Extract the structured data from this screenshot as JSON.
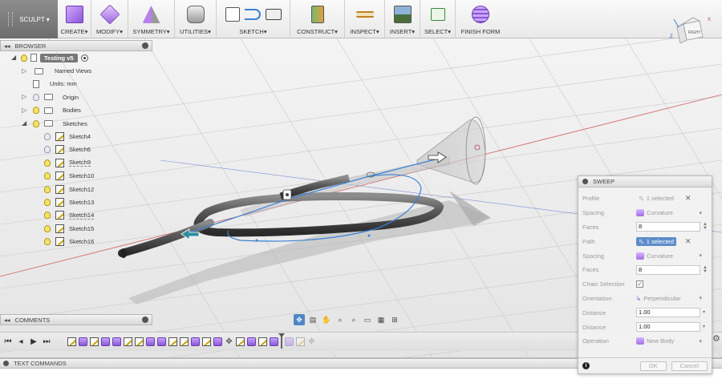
{
  "workspace": {
    "label": "SCULPT"
  },
  "toolbar": {
    "groups": [
      {
        "label": "CREATE"
      },
      {
        "label": "MODIFY"
      },
      {
        "label": "SYMMETRY"
      },
      {
        "label": "UTILITIES"
      },
      {
        "label": "SKETCH"
      },
      {
        "label": "CONSTRUCT"
      },
      {
        "label": "INSPECT"
      },
      {
        "label": "INSERT"
      },
      {
        "label": "SELECT"
      },
      {
        "label": "FINISH FORM"
      }
    ],
    "dropdown_glyph": "▾"
  },
  "viewcube": {
    "face_label": "RIGHT",
    "axis_z": "Z",
    "axis_x": "X"
  },
  "browser": {
    "title": "BROWSER",
    "root": {
      "label": "Testing v5"
    },
    "items": [
      {
        "label": "Named Views"
      },
      {
        "label": "Units: mm"
      },
      {
        "label": "Origin"
      },
      {
        "label": "Bodies"
      },
      {
        "label": "Sketches"
      }
    ],
    "sketches": [
      "Sketch4",
      "Sketch6",
      "Sketch9",
      "Sketch10",
      "Sketch12",
      "Sketch13",
      "Sketch14",
      "Sketch15",
      "Sketch16"
    ]
  },
  "comments": {
    "title": "COMMENTS"
  },
  "text_commands": {
    "title": "TEXT COMMANDS"
  },
  "sweep": {
    "title": "SWEEP",
    "profile": {
      "label": "Profile",
      "value": "1 selected"
    },
    "spacing1": {
      "label": "Spacing",
      "value": "Curvature"
    },
    "faces1": {
      "label": "Faces",
      "value": "8"
    },
    "path": {
      "label": "Path",
      "value": "1 selected"
    },
    "spacing2": {
      "label": "Spacing",
      "value": "Curvature"
    },
    "faces2": {
      "label": "Faces",
      "value": "8"
    },
    "chain": {
      "label": "Chain Selection",
      "checked": true
    },
    "orientation": {
      "label": "Orientation",
      "value": "Perpendicular"
    },
    "distance1": {
      "label": "Distance",
      "value": "1.00"
    },
    "distance2": {
      "label": "Distance",
      "value": "1.00"
    },
    "operation": {
      "label": "Operation",
      "value": "New Body"
    },
    "ok_label": "OK",
    "cancel_label": "Cancel",
    "info_label": "i"
  },
  "colors": {
    "accent_blue": "#5d8cc9",
    "path_blue": "#3b82d6",
    "body_purple": "#a46ee5",
    "sketch_yellow": "#c8a400",
    "axis_red": "#d06060"
  }
}
